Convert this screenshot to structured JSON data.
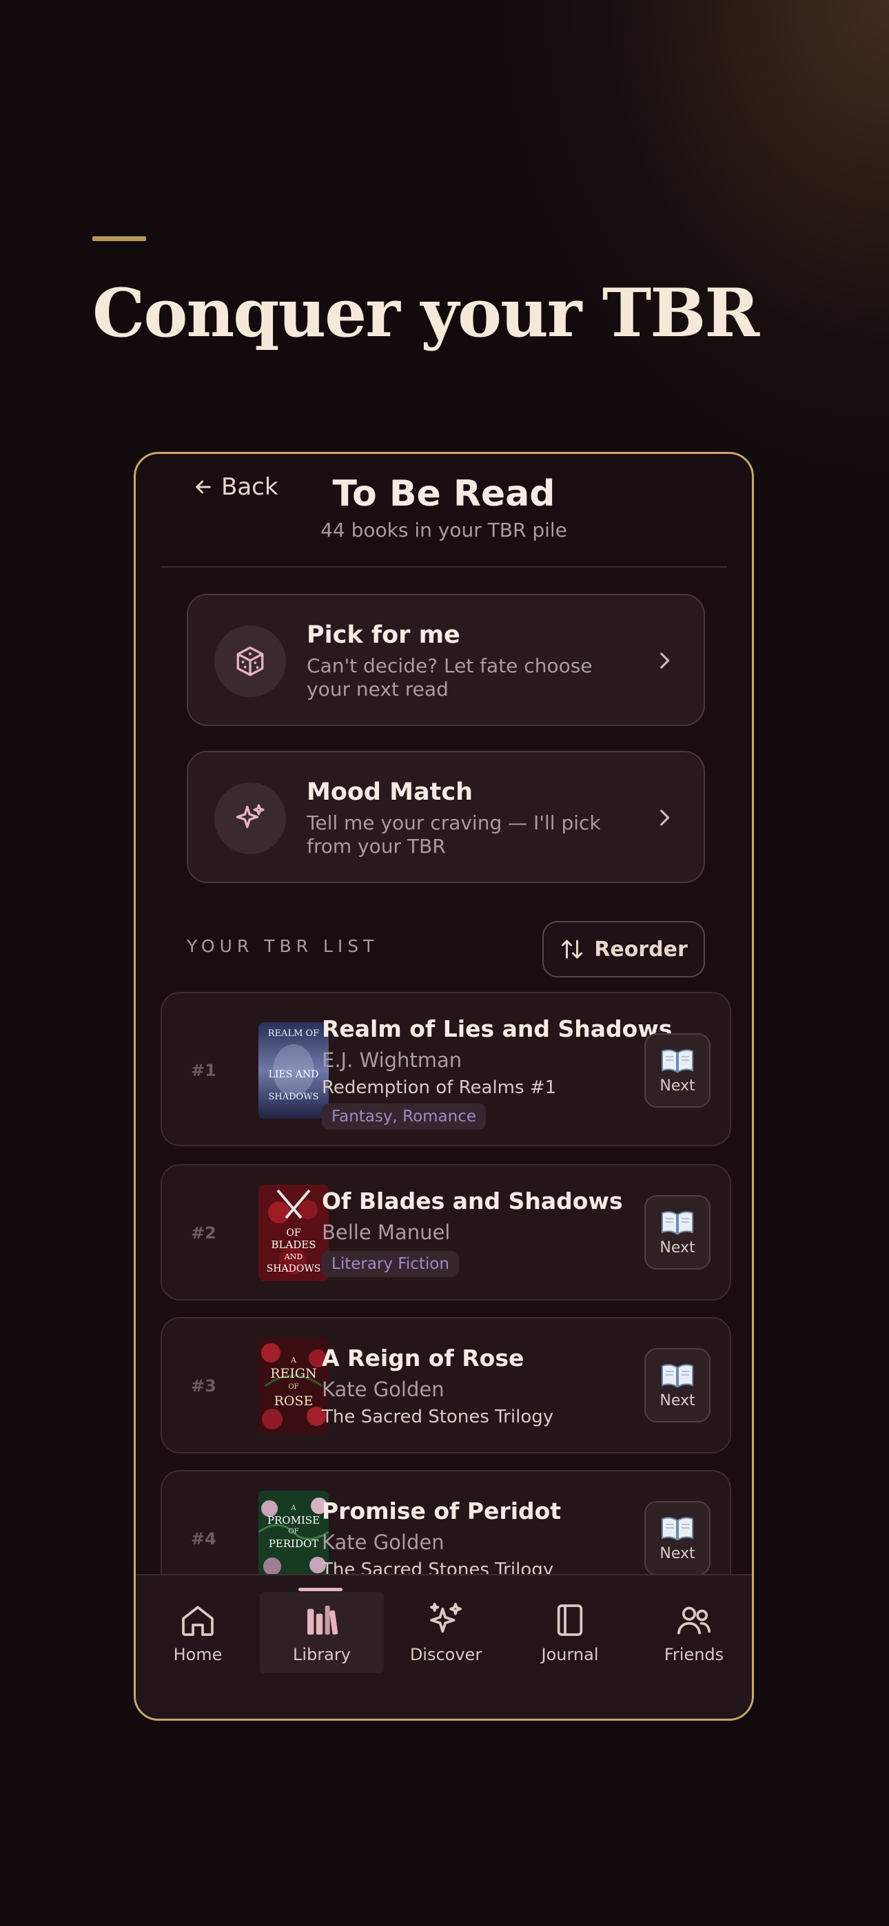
{
  "hero": {
    "title": "Conquer your TBR"
  },
  "header": {
    "back_label": "Back",
    "title": "To Be Read",
    "subtitle": "44 books in your TBR pile"
  },
  "actions": [
    {
      "title": "Pick for me",
      "description": "Can't decide? Let fate choose your next read",
      "icon": "dice-icon"
    },
    {
      "title": "Mood Match",
      "description": "Tell me your craving — I'll pick from your TBR",
      "icon": "sparkles-icon"
    }
  ],
  "list": {
    "section_label": "YOUR TBR LIST",
    "reorder_label": "Reorder",
    "books": [
      {
        "rank": "#1",
        "title": "Realm of Lies and Shadows",
        "author": "E.J. Wightman",
        "series": "Redemption of Realms #1",
        "genres": "Fantasy, Romance",
        "next_label": "Next",
        "cover_text": [
          "REALM OF",
          "LIES AND",
          "SHADOWS"
        ]
      },
      {
        "rank": "#2",
        "title": "Of Blades and Shadows",
        "author": "Belle Manuel",
        "series": "",
        "genres": "Literary Fiction",
        "next_label": "Next",
        "cover_text": [
          "OF",
          "BLADES",
          "AND",
          "SHADOWS"
        ]
      },
      {
        "rank": "#3",
        "title": "A Reign of Rose",
        "author": "Kate  Golden",
        "series": "The Sacred Stones Trilogy",
        "genres": "",
        "next_label": "Next",
        "cover_text": [
          "A",
          "REIGN",
          "OF",
          "ROSE"
        ]
      },
      {
        "rank": "#4",
        "title": "Promise of Peridot",
        "author": "Kate  Golden",
        "series": "The Sacred Stones Trilogy",
        "genres": "",
        "next_label": "Next",
        "cover_text": [
          "A",
          "PROMISE",
          "OF",
          "PERIDOT"
        ]
      }
    ]
  },
  "tabs": [
    {
      "label": "Home",
      "icon": "home-icon",
      "active": false
    },
    {
      "label": "Library",
      "icon": "library-icon",
      "active": true
    },
    {
      "label": "Discover",
      "icon": "sparkles-icon",
      "active": false
    },
    {
      "label": "Journal",
      "icon": "journal-icon",
      "active": false
    },
    {
      "label": "Friends",
      "icon": "friends-icon",
      "active": false
    }
  ],
  "colors": {
    "background": "#120a0d",
    "accent_gold": "#c6a86a",
    "card": "#27191d",
    "tag_text": "#9b8ac8",
    "active_tab": "#e7b4be"
  }
}
